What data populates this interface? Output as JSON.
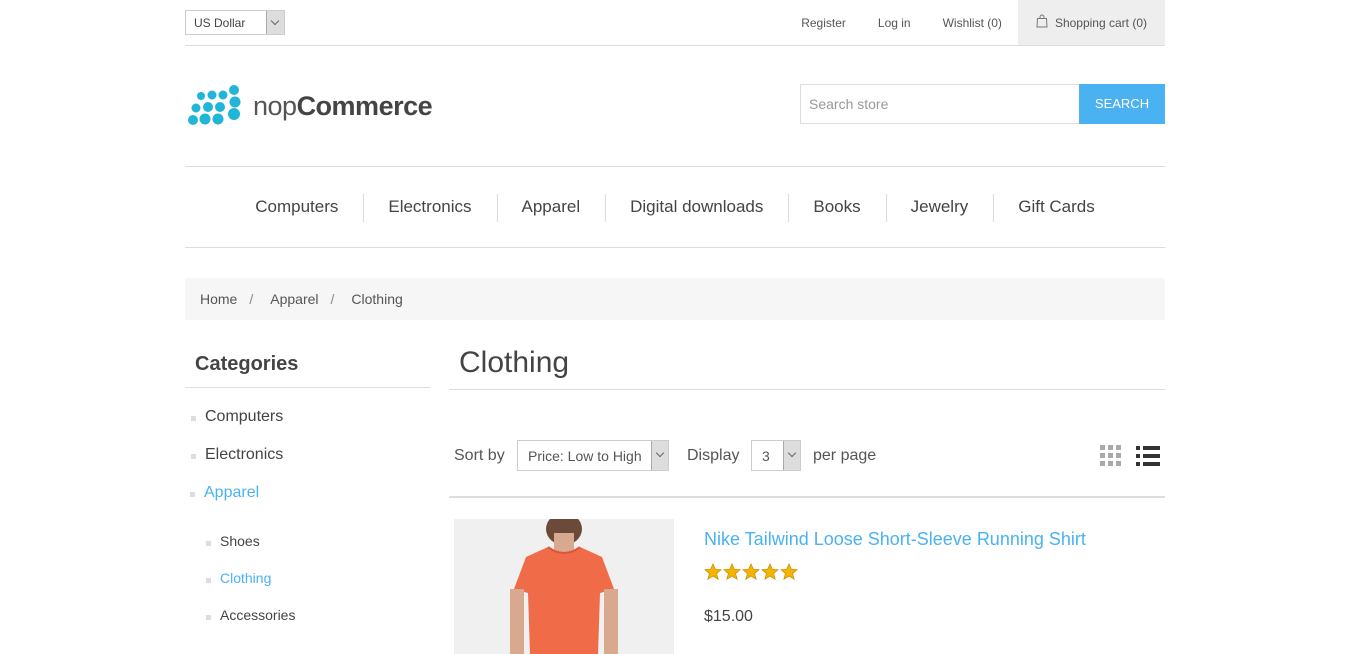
{
  "header": {
    "currency": "US Dollar",
    "links": [
      "Register",
      "Log in",
      "Wishlist (0)"
    ],
    "cart": "Shopping cart (0)",
    "logo_light": "nop",
    "logo_bold": "Commerce",
    "search_placeholder": "Search store",
    "search_button": "Search"
  },
  "menu": [
    "Computers",
    "Electronics",
    "Apparel",
    "Digital downloads",
    "Books",
    "Jewelry",
    "Gift Cards"
  ],
  "breadcrumb": [
    "Home",
    "Apparel",
    "Clothing"
  ],
  "sidebar": {
    "title": "Categories",
    "items": [
      "Computers",
      "Electronics",
      "Apparel"
    ],
    "subitems": [
      "Shoes",
      "Clothing",
      "Accessories"
    ]
  },
  "main": {
    "title": "Clothing",
    "sort_label": "Sort by",
    "sort_value": "Price: Low to High",
    "display_label": "Display",
    "display_value": "3",
    "per_page": "per page"
  },
  "product": {
    "title": "Nike Tailwind Loose Short-Sleeve Running Shirt",
    "rating": 5,
    "price": "$15.00"
  },
  "colors": {
    "accent": "#4ab2f1",
    "star": "#f5b400"
  },
  "icons": [
    "bag-icon",
    "grid-view-icon",
    "list-view-icon",
    "star-icon"
  ]
}
